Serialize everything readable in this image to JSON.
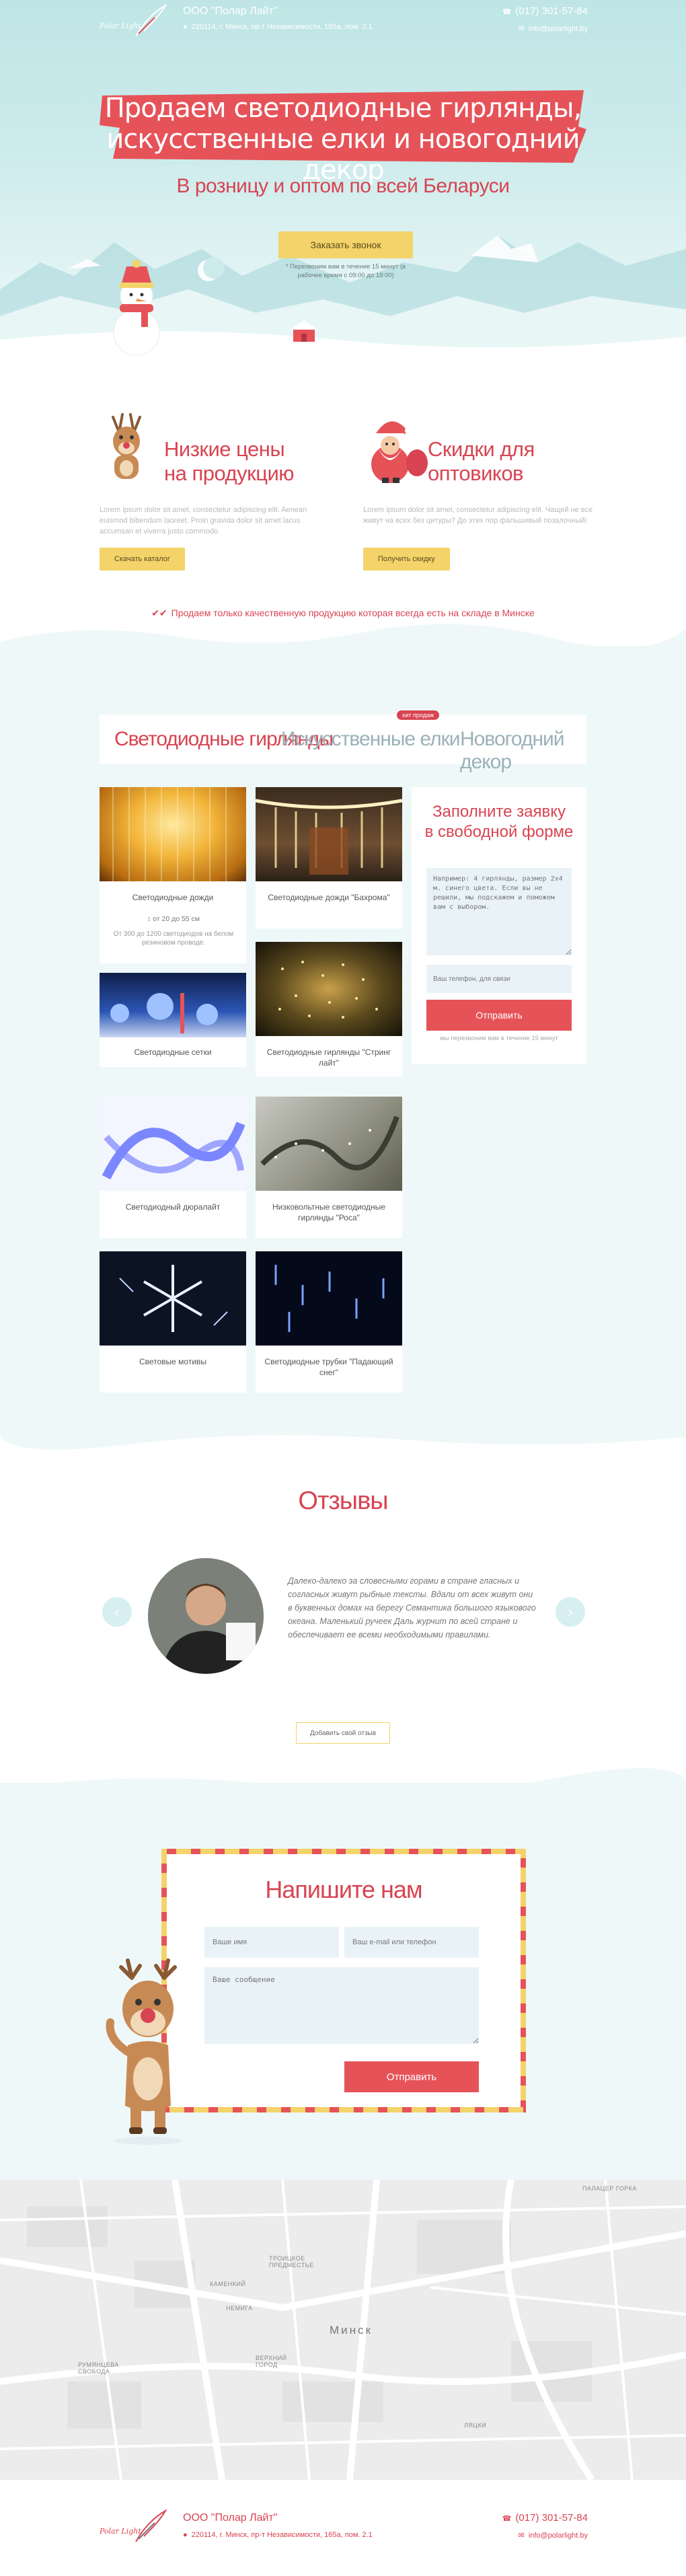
{
  "header": {
    "logo_text": "Polar Light",
    "company": "ООО \"Полар Лайт\"",
    "address": "220114, г. Минск, пр-т Независимости, 165а, пом. 2.1",
    "phone": "(017) 301-57-84",
    "email": "info@polarlight.by"
  },
  "hero": {
    "headline_line1": "Продаем светодиодные гирлянды,",
    "headline_line2": "искусственные елки и новогодний декор",
    "subhead": "В розницу и оптом по всей Беларуси",
    "call_button": "Заказать звонок",
    "call_note": "* Перезвоним вам в течение 15 минут (в рабочее время с 09:00 до 18:00)"
  },
  "features": [
    {
      "title_line1": "Низкие цены",
      "title_line2": "на продукцию",
      "text": "Lorem ipsum dolor sit amet, consectetur adipiscing elit. Aenean euismod bibendum laoreet. Proin gravida dolor sit amet lacus accumsan et viverra justo commodo.",
      "button": "Скачать каталог"
    },
    {
      "title_line1": "Скидки для",
      "title_line2": "оптовиков",
      "text": "Lorem ipsum dolor sit amet, consectetur adipiscing elit. Чащей не все живут на всех без цитуры? До этих пор фальшивый позалочный!",
      "button": "Получить скидку"
    }
  ],
  "promise": "Продаем только качественную продукцию которая всегда есть на складе в Минске",
  "catalog": {
    "tabs": [
      "Светодиодные гирлянды",
      "Искусственные елки",
      "Новогодний декор"
    ],
    "tab_badge": "хит продаж",
    "products": [
      {
        "title": "Светодиодные дожди",
        "size": "от 20 до 55 см",
        "extra": "От 300 до 1200 светодиодов на белом резиновом проводе."
      },
      {
        "title": "Светодиодные дожди \"Бахрома\""
      },
      {
        "title": "Светодиодные сетки"
      },
      {
        "title": "Светодиодные гирлянды \"Стринг лайт\""
      },
      {
        "title": "Светодиодный дюралайт"
      },
      {
        "title": "Низковольтные светодиодные гирлянды \"Роса\""
      },
      {
        "title": "Световые мотивы"
      },
      {
        "title": "Светодиодные трубки \"Падающий снег\""
      }
    ],
    "request": {
      "title_line1": "Заполните заявку",
      "title_line2": "в свободной форме",
      "message_placeholder": "Например: 4 гирлянды, размер 2х4 м. синего цвета. Если вы не решили, мы подскажем и поможем вам с выбором.",
      "phone_placeholder": "Ваш телефон, для связи",
      "send": "Отправить",
      "note": "мы перезвоним вам в течение 15 минут"
    }
  },
  "reviews": {
    "title": "Отзывы",
    "text": "Далеко-далеко за словесными горами в стране гласных и согласных живут рыбные тексты. Вдали от всех живут они в буквенных домах на берегу Семантика большого языкового океана. Маленький ручеек Даль журчит по всей стране и обеспечивает ее всеми необходимыми правилами.",
    "add_button": "Добавить свой отзыв",
    "prev": "‹",
    "next": "›"
  },
  "contact": {
    "title": "Напишите нам",
    "name_placeholder": "Ваше имя",
    "contact_placeholder": "Ваш e-mail или телефон",
    "message_placeholder": "Ваше сообщение",
    "send": "Отправить"
  },
  "map": {
    "city": "Минск",
    "labels": [
      "ПАЛАЦЕР ГОРКА",
      "КАМЕНКИЙ",
      "ТРОИЦКОЕ ПРЕДМЕСТЬЕ",
      "НЕМИГА",
      "ВЕРХНИЙ ГОРОД",
      "РУМЯНЦЕВА СВОБОДА",
      "ЛЯЦКИ"
    ]
  },
  "footer": {
    "logo_text": "Polar Light",
    "company": "ООО \"Полар Лайт\"",
    "address": "220114, г. Минск, пр-т Независимости, 165а, пом. 2.1",
    "phone": "(017) 301-57-84",
    "email": "info@polarlight.by"
  },
  "colors": {
    "accent_red": "#d84452",
    "button_yellow": "#f3d36a",
    "sky": "#bfe5e6",
    "section_bg": "#eff8f9"
  }
}
